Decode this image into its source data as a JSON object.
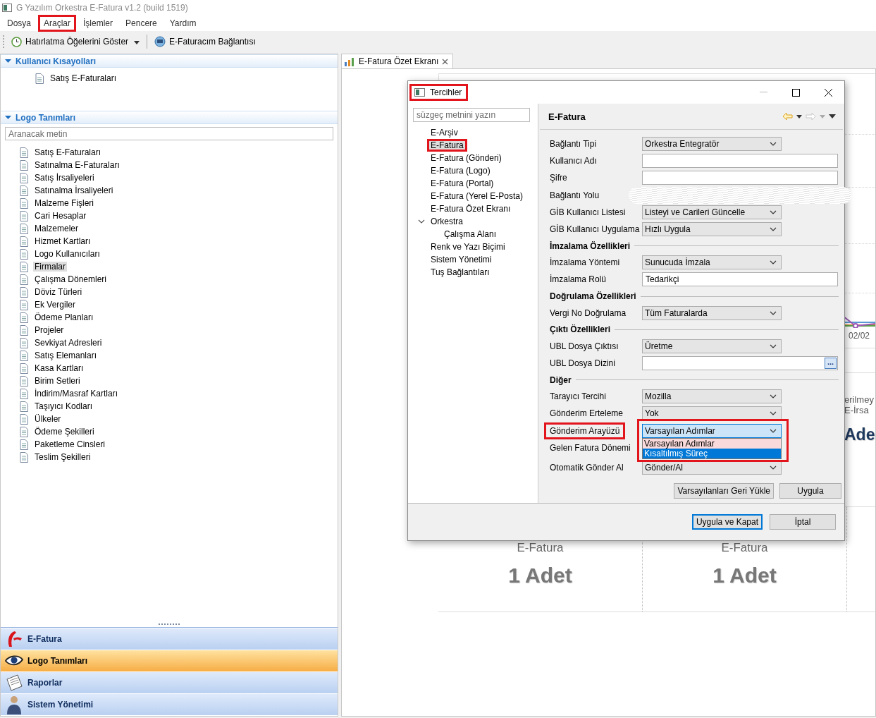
{
  "window": {
    "title": "G Yazılım Orkestra E-Fatura v1.2 (build 1519)"
  },
  "menu": [
    {
      "label": "Dosya",
      "highlighted": false
    },
    {
      "label": "Araçlar",
      "highlighted": true
    },
    {
      "label": "İşlemler",
      "highlighted": false
    },
    {
      "label": "Pencere",
      "highlighted": false
    },
    {
      "label": "Yardım",
      "highlighted": false
    }
  ],
  "toolbar": [
    {
      "label": "Hatırlatma Öğelerini Göster",
      "dropdown": true
    },
    {
      "label": "E-Faturacım Bağlantısı",
      "dropdown": false
    }
  ],
  "sidebar": {
    "sections": [
      {
        "title": "Kullanıcı Kısayolları",
        "expanded": true,
        "items": [
          {
            "label": "Satış E-Faturaları",
            "selected": false
          }
        ]
      },
      {
        "title": "Logo Tanımları",
        "expanded": true,
        "search": {
          "placeholder": "Aranacak metin"
        },
        "items": [
          {
            "label": "Satış E-Faturaları",
            "selected": false
          },
          {
            "label": "Satınalma E-Faturaları",
            "selected": false
          },
          {
            "label": "Satış İrsaliyeleri",
            "selected": false
          },
          {
            "label": "Satınalma İrsaliyeleri",
            "selected": false
          },
          {
            "label": "Malzeme Fişleri",
            "selected": false
          },
          {
            "label": "Cari Hesaplar",
            "selected": false
          },
          {
            "label": "Malzemeler",
            "selected": false
          },
          {
            "label": "Hizmet Kartları",
            "selected": false
          },
          {
            "label": "Logo Kullanıcıları",
            "selected": false
          },
          {
            "label": "Firmalar",
            "selected": true
          },
          {
            "label": "Çalışma Dönemleri",
            "selected": false
          },
          {
            "label": "Döviz Türleri",
            "selected": false
          },
          {
            "label": "Ek Vergiler",
            "selected": false
          },
          {
            "label": "Ödeme Planları",
            "selected": false
          },
          {
            "label": "Projeler",
            "selected": false
          },
          {
            "label": "Sevkiyat Adresleri",
            "selected": false
          },
          {
            "label": "Satış Elemanları",
            "selected": false
          },
          {
            "label": "Kasa Kartları",
            "selected": false
          },
          {
            "label": "Birim Setleri",
            "selected": false
          },
          {
            "label": "İndirim/Masraf Kartları",
            "selected": false
          },
          {
            "label": "Taşıyıcı Kodları",
            "selected": false
          },
          {
            "label": "Ülkeler",
            "selected": false
          },
          {
            "label": "Ödeme Şekilleri",
            "selected": false
          },
          {
            "label": "Paketleme Cinsleri",
            "selected": false
          },
          {
            "label": "Teslim Şekilleri",
            "selected": false
          }
        ]
      }
    ]
  },
  "navigator": [
    {
      "label": "E-Fatura",
      "selected": false
    },
    {
      "label": "Logo Tanımları",
      "selected": true
    },
    {
      "label": "Raporlar",
      "selected": false
    },
    {
      "label": "Sistem Yönetimi",
      "selected": false
    }
  ],
  "editor": {
    "tabs": [
      {
        "label": "E-Fatura Özet Ekranı",
        "selected": true
      }
    ],
    "chart": {
      "tick_label": "02/02"
    },
    "stat_rows": [
      [
        {
          "lines": [
            "erilmey",
            "E-İrsa"
          ],
          "value": "Ade"
        }
      ],
      [
        {
          "lines": [
            "E-Fatura"
          ],
          "value": "1 Adet"
        },
        {
          "lines": [
            "E-Fatura"
          ],
          "value": "1 Adet"
        }
      ]
    ]
  },
  "dialog": {
    "title": "Tercihler",
    "highlighted": true,
    "filter": {
      "placeholder": "süzgeç metnini yazın"
    },
    "tree": [
      {
        "label": "E-Arşiv",
        "selected": false,
        "highlighted": false
      },
      {
        "label": "E-Fatura",
        "selected": true,
        "highlighted": true
      },
      {
        "label": "E-Fatura (Gönderi)",
        "selected": false,
        "highlighted": false
      },
      {
        "label": "E-Fatura (Logo)",
        "selected": false,
        "highlighted": false
      },
      {
        "label": "E-Fatura (Portal)",
        "selected": false,
        "highlighted": false
      },
      {
        "label": "E-Fatura (Yerel E-Posta)",
        "selected": false,
        "highlighted": false
      },
      {
        "label": "E-Fatura Özet Ekranı",
        "selected": false,
        "highlighted": false
      },
      {
        "label": "Orkestra",
        "selected": false,
        "highlighted": false,
        "expanded": true,
        "children": [
          {
            "label": "Çalışma Alanı",
            "selected": false,
            "highlighted": false
          }
        ]
      },
      {
        "label": "Renk ve Yazı Biçimi",
        "selected": false,
        "highlighted": false
      },
      {
        "label": "Sistem Yönetimi",
        "selected": false,
        "highlighted": false
      },
      {
        "label": "Tuş Bağlantıları",
        "selected": false,
        "highlighted": false
      }
    ],
    "page": {
      "title": "E-Fatura",
      "back_enabled": true,
      "forward_enabled": false,
      "rows": [
        {
          "kind": "combo",
          "label": "Bağlantı Tipi",
          "value": "Orkestra Entegratör"
        },
        {
          "kind": "text",
          "label": "Kullanıcı Adı"
        },
        {
          "kind": "text",
          "label": "Şifre"
        },
        {
          "kind": "text",
          "label": "Bağlantı Yolu",
          "redacted": true
        },
        {
          "kind": "combo",
          "label": "GİB Kullanıcı Listesi",
          "value": "Listeyi ve Carileri Güncelle"
        },
        {
          "kind": "combo",
          "label": "GİB Kullanıcı Uygulama",
          "value": "Hızlı Uygula"
        },
        {
          "kind": "section",
          "label": "İmzalama Özellikleri"
        },
        {
          "kind": "combo",
          "label": "İmzalama Yöntemi",
          "value": "Sunucuda İmzala"
        },
        {
          "kind": "text",
          "label": "İmzalama Rolü",
          "value": "Tedarikçi"
        },
        {
          "kind": "section",
          "label": "Doğrulama Özellikleri"
        },
        {
          "kind": "combo",
          "label": "Vergi No Doğrulama",
          "value": "Tüm Faturalarda"
        },
        {
          "kind": "section",
          "label": "Çıktı Özellikleri"
        },
        {
          "kind": "combo",
          "label": "UBL Dosya Çıktısı",
          "value": "Üretme"
        },
        {
          "kind": "browse",
          "label": "UBL Dosya Dizini",
          "button": "..."
        },
        {
          "kind": "section",
          "label": "Diğer"
        },
        {
          "kind": "combo",
          "label": "Tarayıcı Tercihi",
          "value": "Mozilla"
        },
        {
          "kind": "combo",
          "label": "Gönderim Erteleme",
          "value": "Yok"
        },
        {
          "kind": "combo",
          "label": "Gönderim Arayüzü",
          "value": "Varsayılan Adımlar",
          "label_highlighted": true,
          "highlighted": true,
          "open": true,
          "options": [
            {
              "label": "Varsayılan Adımlar",
              "selected": true,
              "hovered": false
            },
            {
              "label": "Kısaltılmış Süreç",
              "selected": false,
              "hovered": true
            }
          ]
        },
        {
          "kind": "label",
          "label": "Gelen Fatura Dönemi"
        },
        {
          "kind": "combo",
          "label": "Otomatik Gönder Al",
          "value": "Gönder/Al"
        }
      ],
      "buttons": [
        {
          "label": "Varsayılanları Geri Yükle",
          "default": false
        },
        {
          "label": "Uygula",
          "default": false
        }
      ]
    },
    "buttons": [
      {
        "label": "Uygula ve Kapat",
        "default": true
      },
      {
        "label": "İptal",
        "default": false
      }
    ]
  }
}
